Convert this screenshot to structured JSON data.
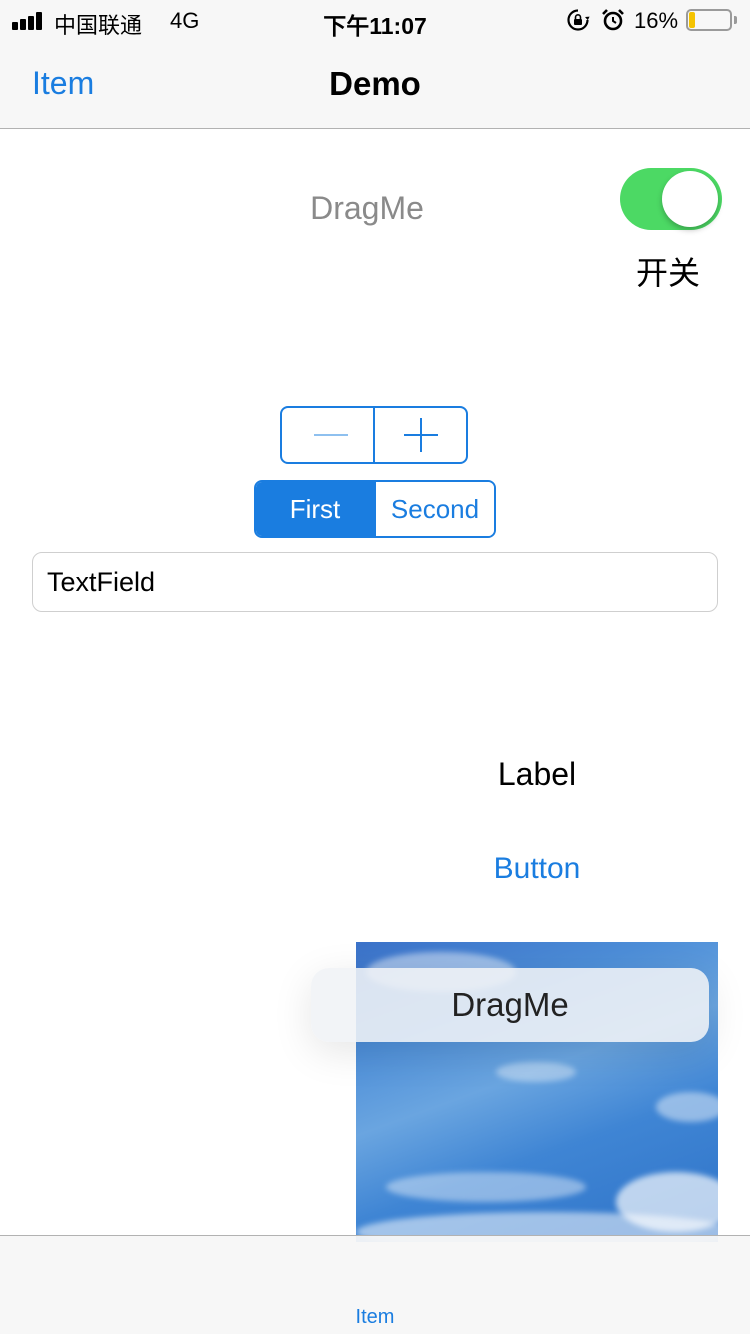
{
  "status_bar": {
    "carrier": "中国联通",
    "network": "4G",
    "time": "下午11:07",
    "battery_percent": "16%",
    "battery_level": 0.16,
    "signal_bars": 4,
    "icons": [
      "signal-icon",
      "orientation-lock-icon",
      "alarm-icon",
      "battery-icon"
    ]
  },
  "nav": {
    "left_item": "Item",
    "title": "Demo"
  },
  "content": {
    "drag_label_top": "DragMe",
    "switch": {
      "on": true,
      "label": "开关"
    },
    "stepper": {
      "icons": [
        "minus-icon",
        "plus-icon"
      ]
    },
    "segmented": {
      "segments": [
        "First",
        "Second"
      ],
      "selected": "First"
    },
    "textfield": {
      "value": "TextField"
    },
    "label": "Label",
    "button": "Button",
    "drag_float": "DragMe"
  },
  "tab_bar": {
    "items": [
      "Item"
    ]
  },
  "colors": {
    "accent": "#1a7de0",
    "switch_on": "#4cd964",
    "bar_background": "#f7f7f7",
    "battery_low": "#f5c300"
  }
}
